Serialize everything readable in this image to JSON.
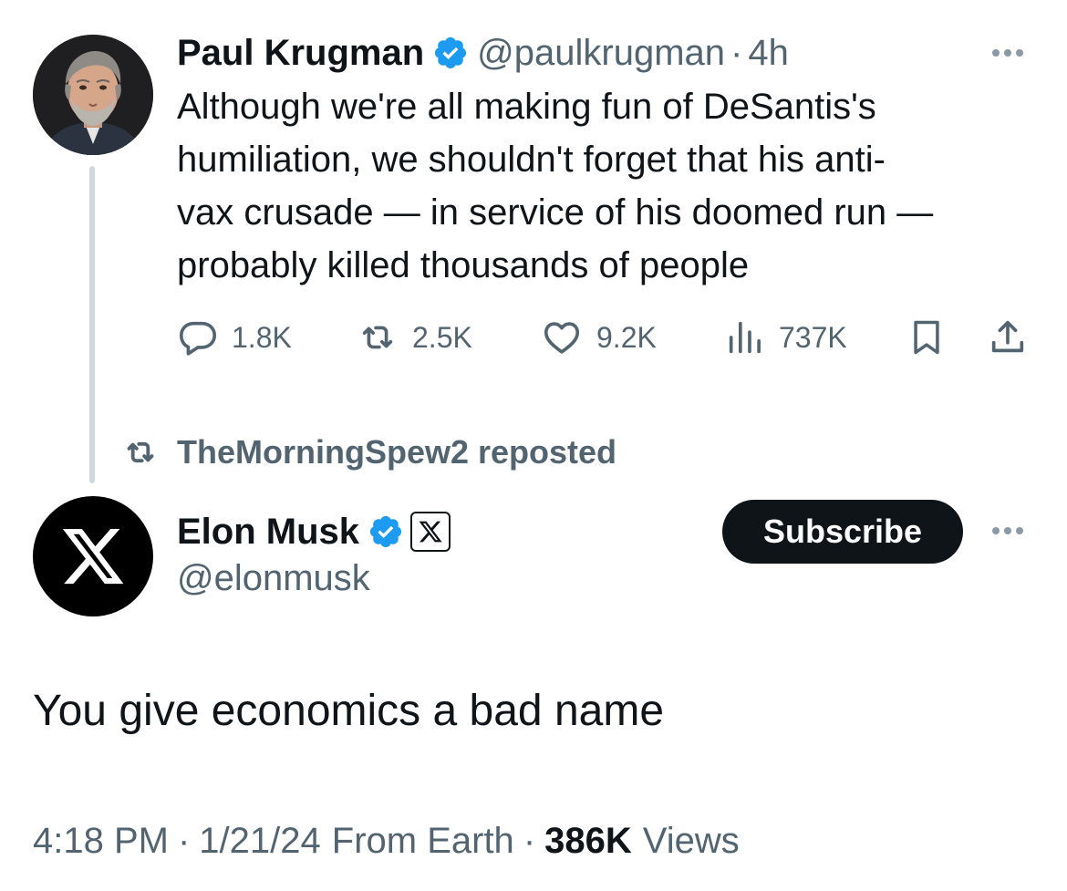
{
  "parent_tweet": {
    "author_name": "Paul Krugman",
    "handle": "@paulkrugman",
    "time": "4h",
    "text_lines": [
      "Although we're all making fun of DeSantis's",
      "humiliation, we shouldn't forget that his anti-",
      "vax crusade — in service of his doomed run —",
      "probably killed thousands of people"
    ],
    "metrics": {
      "replies": "1.8K",
      "reposts": "2.5K",
      "likes": "9.2K",
      "views": "737K"
    }
  },
  "repost": {
    "text": "TheMorningSpew2 reposted"
  },
  "main_tweet": {
    "author_name": "Elon Musk",
    "handle": "@elonmusk",
    "subscribe_label": "Subscribe",
    "text": "You give economics a bad name",
    "time": "4:18 PM",
    "date": "1/21/24",
    "source": "From Earth",
    "views_count": "386K",
    "views_label": "Views"
  },
  "colors": {
    "text_primary": "#0f1419",
    "text_secondary": "#536471",
    "verified_blue": "#1d9bf0",
    "thread_line": "#cfd9de",
    "button_dark": "#0f1419"
  },
  "icons": [
    "reply-icon",
    "repost-icon",
    "like-icon",
    "views-icon",
    "bookmark-icon",
    "share-icon",
    "verified-icon",
    "x-logo-icon",
    "more-icon"
  ]
}
